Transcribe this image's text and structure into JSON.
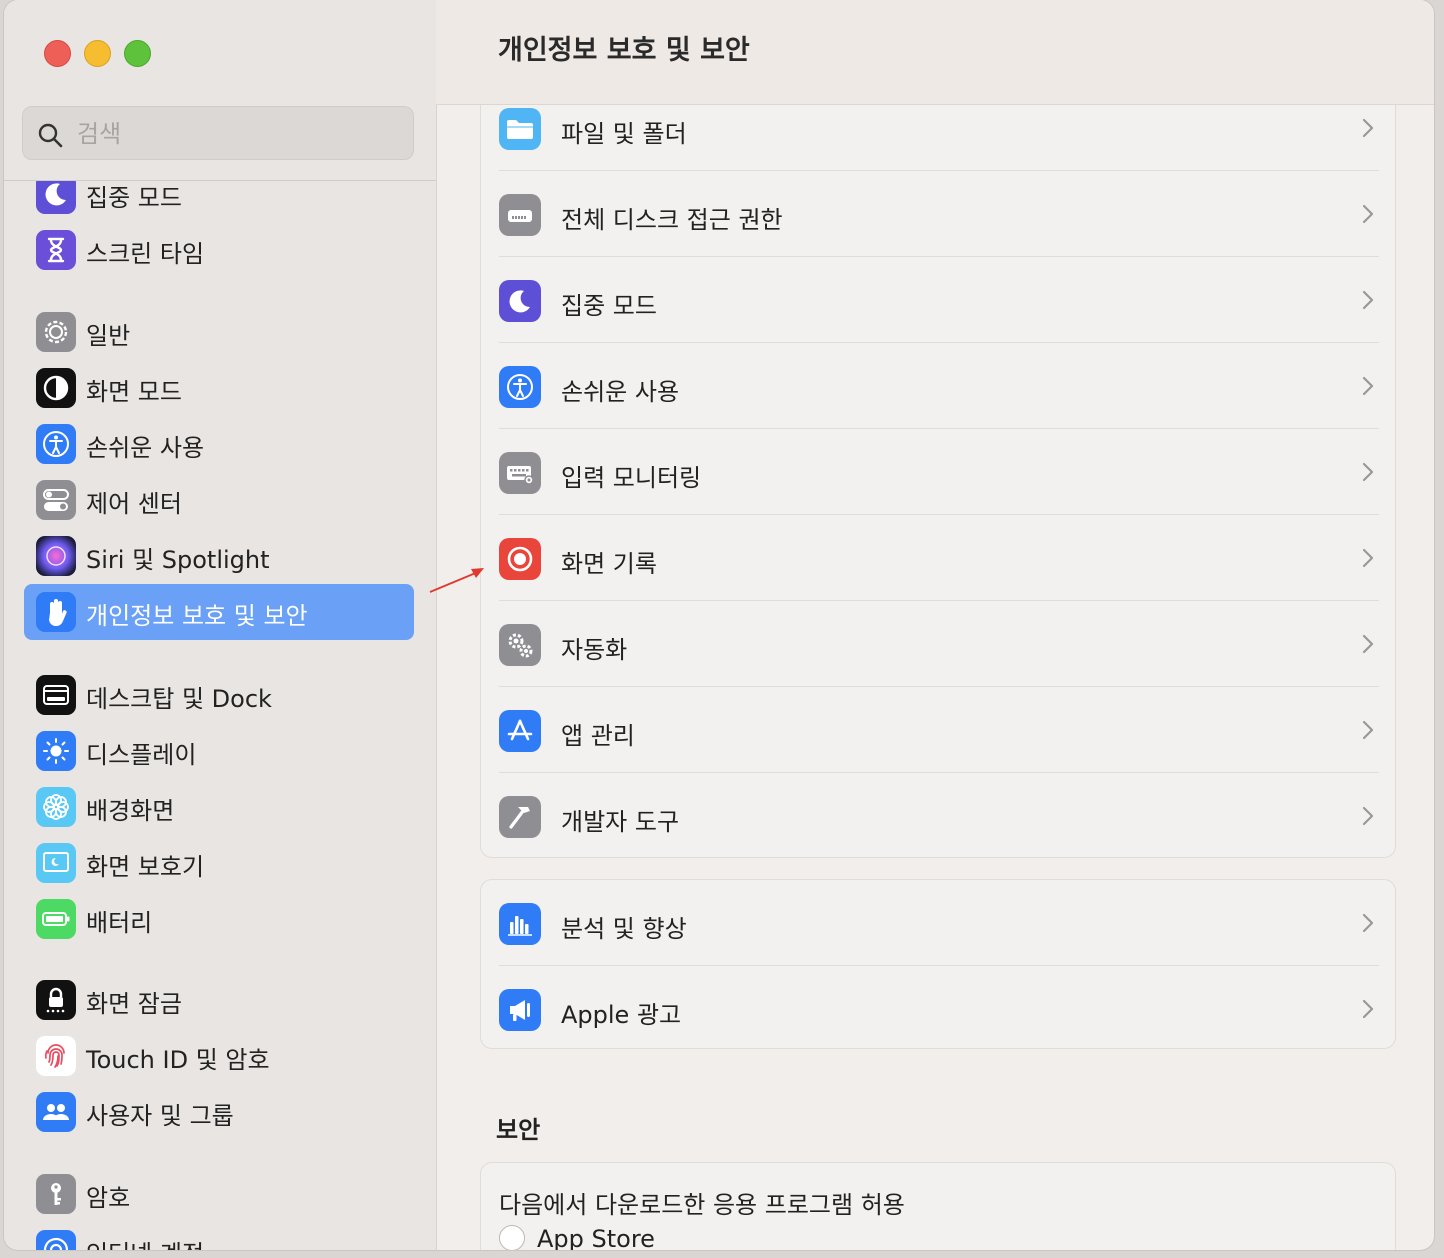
{
  "window": {
    "title": "개인정보 보호 및 보안"
  },
  "search": {
    "placeholder": "검색"
  },
  "sidebar": {
    "items": [
      {
        "label": "집중 모드"
      },
      {
        "label": "스크린 타임"
      },
      {
        "label": "일반"
      },
      {
        "label": "화면 모드"
      },
      {
        "label": "손쉬운 사용"
      },
      {
        "label": "제어 센터"
      },
      {
        "label": "Siri 및 Spotlight"
      },
      {
        "label": "개인정보 보호 및 보안",
        "selected": true
      },
      {
        "label": "데스크탑 및 Dock"
      },
      {
        "label": "디스플레이"
      },
      {
        "label": "배경화면"
      },
      {
        "label": "화면 보호기"
      },
      {
        "label": "배터리"
      },
      {
        "label": "화면 잠금"
      },
      {
        "label": "Touch ID 및 암호"
      },
      {
        "label": "사용자 및 그룹"
      },
      {
        "label": "암호"
      },
      {
        "label": "인터넷 계정"
      }
    ]
  },
  "privacy_rows": [
    {
      "label": "파일 및 폴더",
      "icon": "folder-icon"
    },
    {
      "label": "전체 디스크 접근 권한",
      "icon": "disk-icon"
    },
    {
      "label": "집중 모드",
      "icon": "moon-icon"
    },
    {
      "label": "손쉬운 사용",
      "icon": "accessibility-icon"
    },
    {
      "label": "입력 모니터링",
      "icon": "keyboard-icon"
    },
    {
      "label": "화면 기록",
      "icon": "record-icon"
    },
    {
      "label": "자동화",
      "icon": "gears-icon"
    },
    {
      "label": "앱 관리",
      "icon": "app-store-icon"
    },
    {
      "label": "개발자 도구",
      "icon": "hammer-icon"
    }
  ],
  "analytics_rows": [
    {
      "label": "분석 및 향상",
      "icon": "chart-icon"
    },
    {
      "label": "Apple 광고",
      "icon": "megaphone-icon"
    }
  ],
  "security": {
    "title": "보안",
    "allow_label": "다음에서 다운로드한 응용 프로그램 허용",
    "option_app_store": "App Store"
  },
  "colors": {
    "selected": "#6aa1f6",
    "accent_blue": "#3b82f6",
    "record_red": "#e9453b"
  }
}
